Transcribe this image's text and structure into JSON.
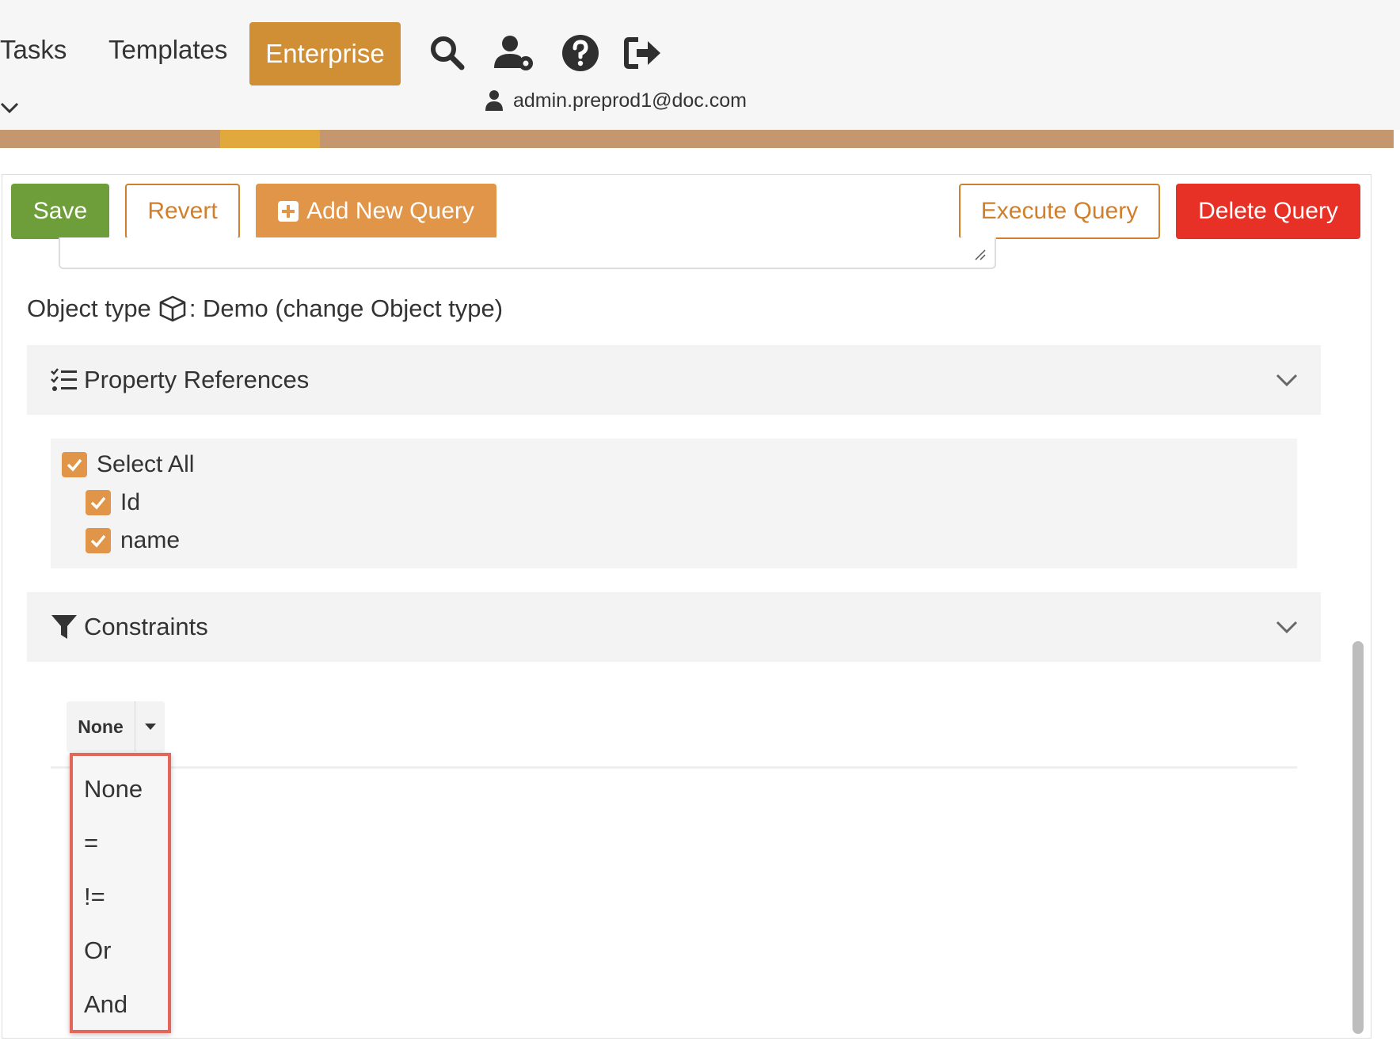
{
  "header": {
    "nav": {
      "tasks": "Tasks",
      "templates": "Templates",
      "enterprise": "Enterprise"
    },
    "icons": [
      "search-icon",
      "user-settings-icon",
      "help-icon",
      "logout-icon"
    ],
    "user_email": "admin.preprod1@doc.com"
  },
  "toolbar": {
    "save": "Save",
    "revert": "Revert",
    "add_new_query": "Add New Query",
    "execute_query": "Execute Query",
    "delete_query": "Delete Query"
  },
  "object_type": {
    "label": "Object type",
    "value": ": Demo (change Object type)"
  },
  "property_references": {
    "title": "Property References",
    "select_all": "Select All",
    "items": [
      "Id",
      "name"
    ],
    "all_checked": true
  },
  "constraints": {
    "title": "Constraints",
    "selected": "None",
    "options": [
      "None",
      "=",
      "!=",
      "Or",
      "And"
    ]
  },
  "colors": {
    "accent": "#d18f35",
    "save": "#6e9e3a",
    "delete": "#e73127",
    "checkbox": "#e09549",
    "highlight_border": "#e4655a"
  }
}
